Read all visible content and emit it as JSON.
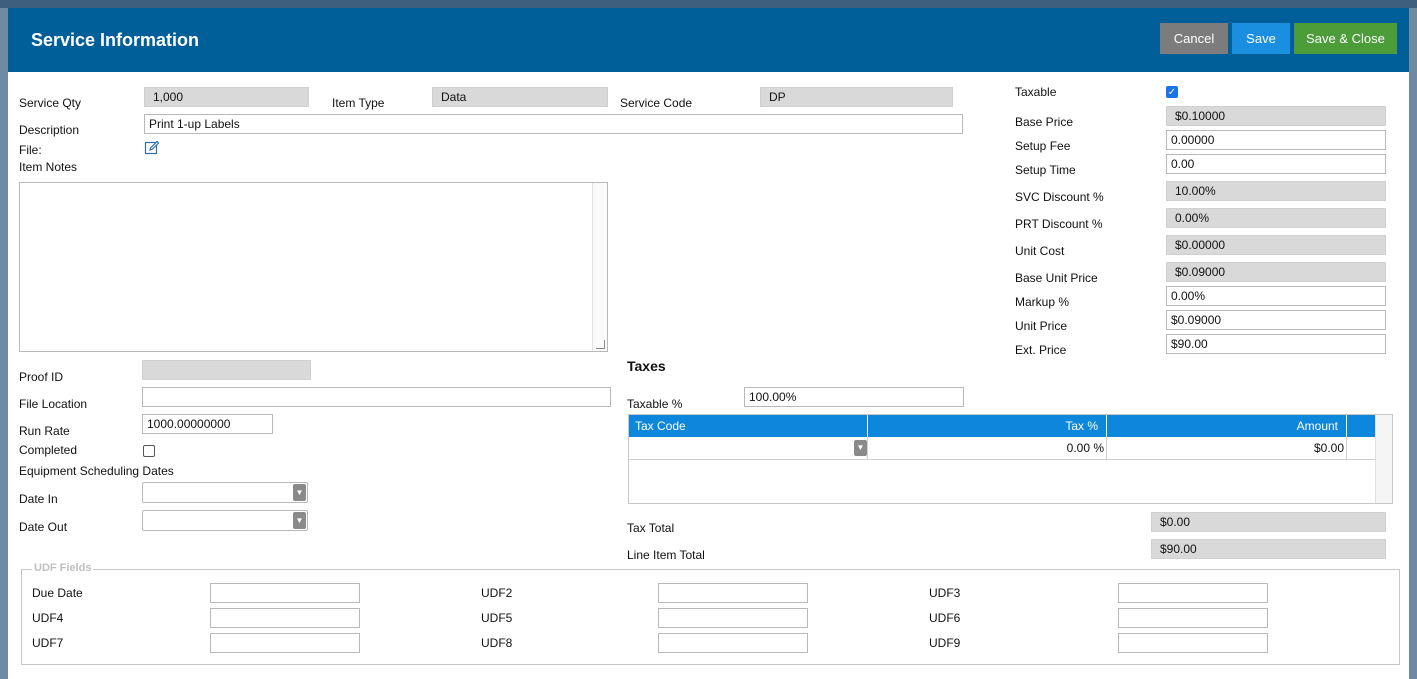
{
  "header": {
    "title": "Service Information",
    "cancel_label": "Cancel",
    "save_label": "Save",
    "save_close_label": "Save & Close"
  },
  "top": {
    "service_qty_label": "Service Qty",
    "service_qty": "1,000",
    "item_type_label": "Item Type",
    "item_type": "Data",
    "service_code_label": "Service Code",
    "service_code": "DP",
    "description_label": "Description",
    "description": "Print 1-up Labels",
    "file_label": "File:",
    "item_notes_label": "Item Notes"
  },
  "left": {
    "proof_id_label": "Proof ID",
    "proof_id": "",
    "file_location_label": "File Location",
    "file_location": "",
    "run_rate_label": "Run Rate",
    "run_rate": "1000.00000000",
    "completed_label": "Completed",
    "scheduling_label": "Equipment Scheduling Dates",
    "date_in_label": "Date In",
    "date_out_label": "Date Out"
  },
  "pricing": {
    "taxable_label": "Taxable",
    "base_price_label": "Base Price",
    "base_price": "$0.10000",
    "setup_fee_label": "Setup Fee",
    "setup_fee": "0.00000",
    "setup_time_label": "Setup Time",
    "setup_time": "0.00",
    "svc_discount_label": "SVC Discount %",
    "svc_discount": "10.00%",
    "prt_discount_label": "PRT Discount %",
    "prt_discount": "0.00%",
    "unit_cost_label": "Unit Cost",
    "unit_cost": "$0.00000",
    "base_unit_price_label": "Base Unit Price",
    "base_unit_price": "$0.09000",
    "markup_label": "Markup %",
    "markup": "0.00%",
    "unit_price_label": "Unit Price",
    "unit_price": "$0.09000",
    "ext_price_label": "Ext. Price",
    "ext_price": "$90.00"
  },
  "taxes": {
    "title": "Taxes",
    "taxable_pct_label": "Taxable %",
    "taxable_pct": "100.00%",
    "columns": {
      "code": "Tax Code",
      "pct": "Tax %",
      "amount": "Amount"
    },
    "row": {
      "code": "",
      "pct": "0.00 %",
      "amount": "$0.00"
    },
    "tax_total_label": "Tax Total",
    "tax_total": "$0.00",
    "line_total_label": "Line Item Total",
    "line_total": "$90.00"
  },
  "udf": {
    "legend": "UDF Fields",
    "labels": [
      "Due Date",
      "UDF2",
      "UDF3",
      "UDF4",
      "UDF5",
      "UDF6",
      "UDF7",
      "UDF8",
      "UDF9"
    ]
  }
}
